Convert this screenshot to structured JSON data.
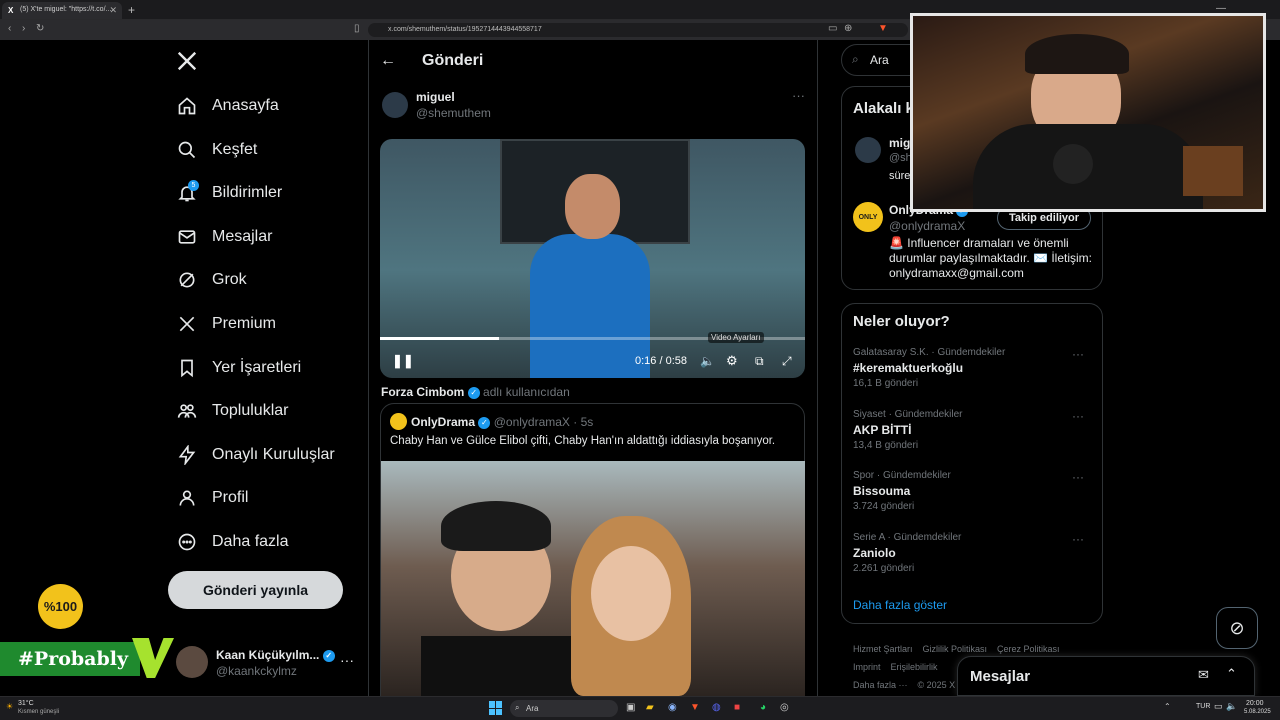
{
  "browser": {
    "tab_title": "(5) X'te miguel: \"https://t.co/...",
    "tab_icon": "X",
    "url": "x.com/shemuthem/status/1952714443944558717"
  },
  "sidebar": {
    "logo": "X",
    "items": [
      {
        "label": "Anasayfa",
        "icon": "home-icon"
      },
      {
        "label": "Keşfet",
        "icon": "search-icon"
      },
      {
        "label": "Bildirimler",
        "icon": "bell-icon",
        "badge": "5"
      },
      {
        "label": "Mesajlar",
        "icon": "mail-icon"
      },
      {
        "label": "Grok",
        "icon": "grok-icon"
      },
      {
        "label": "Premium",
        "icon": "x-logo-icon"
      },
      {
        "label": "Yer İşaretleri",
        "icon": "bookmark-icon"
      },
      {
        "label": "Topluluklar",
        "icon": "people-icon"
      },
      {
        "label": "Onaylı Kuruluşlar",
        "icon": "lightning-icon"
      },
      {
        "label": "Profil",
        "icon": "person-icon"
      },
      {
        "label": "Daha fazla",
        "icon": "more-circle-icon"
      }
    ],
    "post_button": "Gönderi yayınla",
    "account": {
      "name": "Kaan Küçükyılm...",
      "handle": "@kaankckylmz"
    }
  },
  "overlay": {
    "logo_text": "%100",
    "tag": "#Probably"
  },
  "post": {
    "header_title": "Gönderi",
    "author_name": "miguel",
    "author_handle": "@shemuthem",
    "video": {
      "time": "0:16 / 0:58",
      "tooltip": "Video Ayarları",
      "progress": 0.28
    },
    "attribution_name": "Forza Cimbom",
    "attribution_suffix": "adlı kullanıcıdan",
    "quote": {
      "name": "OnlyDrama",
      "handle": "@onlydramaX",
      "time": "· 5s",
      "text": "Chaby Han ve Gülce Elibol çifti, Chaby Han'ın aldattığı iddiasıyla boşanıyor."
    }
  },
  "right": {
    "search_placeholder": "Ara",
    "relevant_title": "Alakalı kişiler",
    "relevant": [
      {
        "name": "miguel",
        "handle": "@shemuthem",
        "bio": "süre..."
      },
      {
        "name": "OnlyDrama",
        "handle": "@onlydramaX",
        "button": "Takip ediliyor",
        "bio": "🚨 Influencer dramaları ve önemli durumlar paylaşılmaktadır. ✉️ İletişim: onlydramaxx@gmail.com"
      }
    ],
    "trends_title": "Neler oluyor?",
    "trends": [
      {
        "category": "Galatasaray S.K. · Gündemdekiler",
        "name": "#keremaktuerkoğlu",
        "count": "16,1 B gönderi"
      },
      {
        "category": "Siyaset · Gündemdekiler",
        "name": "AKP BİTTİ",
        "count": "13,4 B gönderi"
      },
      {
        "category": "Spor · Gündemdekiler",
        "name": "Bissouma",
        "count": "3.724 gönderi"
      },
      {
        "category": "Serie A · Gündemdekiler",
        "name": "Zaniolo",
        "count": "2.261 gönderi"
      }
    ],
    "show_more": "Daha fazla göster",
    "footer_links": [
      "Hizmet Şartları",
      "Gizlilik Politikası",
      "Çerez Politikası",
      "Imprint",
      "Erişilebilirlik",
      "Daha fazla ···",
      "© 2025 X"
    ],
    "messages": "Mesajlar"
  },
  "taskbar": {
    "weather_temp": "31°C",
    "weather_desc": "Kısmen güneşli",
    "search": "Ara",
    "lang": "TUR",
    "time": "20:00",
    "date": "5.08.2025"
  },
  "colors": {
    "accent": "#1d9bf0",
    "bg": "#000000",
    "border": "#2f3336",
    "muted": "#71767b"
  }
}
